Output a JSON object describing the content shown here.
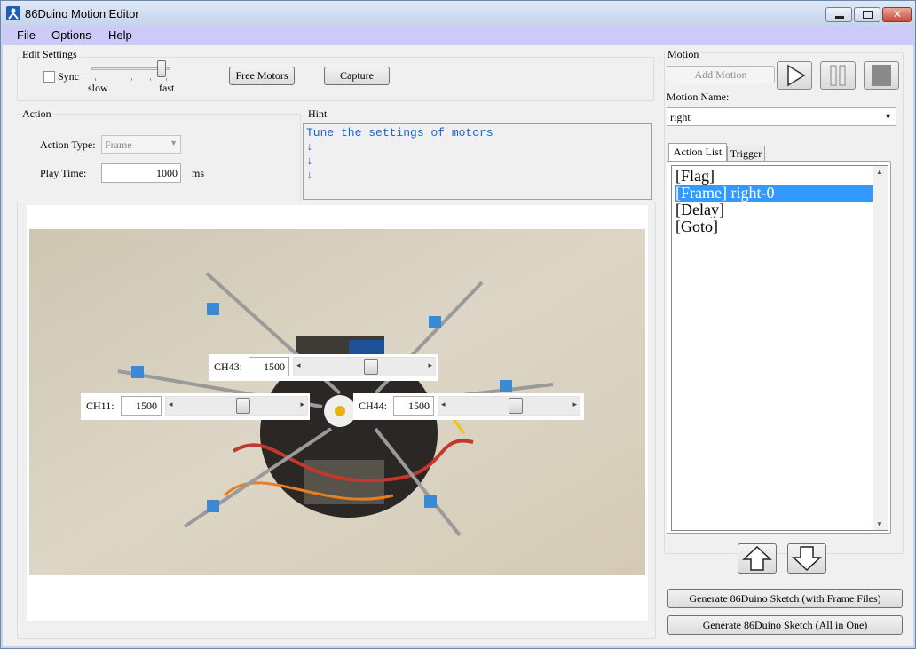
{
  "window": {
    "title": "86Duino Motion Editor"
  },
  "menu": {
    "file": "File",
    "options": "Options",
    "help": "Help"
  },
  "edit_settings": {
    "group_label": "Edit Settings",
    "sync_label": "Sync",
    "sync_checked": false,
    "slider_min_label": "slow",
    "slider_max_label": "fast",
    "speed_level": 1.0,
    "free_motors": "Free Motors",
    "capture": "Capture"
  },
  "action": {
    "group_label": "Action",
    "type_label": "Action Type:",
    "type_value": "Frame",
    "play_time_label": "Play Time:",
    "play_time_value": "1000",
    "play_time_unit": "ms"
  },
  "hint": {
    "group_label": "Hint",
    "lines": [
      "Tune the settings of motors",
      "↓",
      "↓",
      "↓"
    ]
  },
  "channels": [
    {
      "label": "CH43:",
      "value": "1500",
      "level": 0.5
    },
    {
      "label": "CH11:",
      "value": "1500",
      "level": 0.5
    },
    {
      "label": "CH44:",
      "value": "1500",
      "level": 0.5
    }
  ],
  "motion": {
    "group_label": "Motion",
    "add_motion": "Add Motion",
    "name_label": "Motion Name:",
    "name_value": "right",
    "tabs": [
      "Action List",
      "Trigger"
    ],
    "action_list": [
      "[Flag]",
      "[Frame] right-0",
      "[Delay]",
      "[Goto]"
    ],
    "selected_index": 1,
    "generate_frame_files": "Generate 86Duino Sketch (with Frame Files)",
    "generate_all_in_one": "Generate 86Duino Sketch (All in One)"
  },
  "colors": {
    "accent": "#3399ff",
    "hint_text": "#1e64c8",
    "menubar": "#cccaf8"
  }
}
